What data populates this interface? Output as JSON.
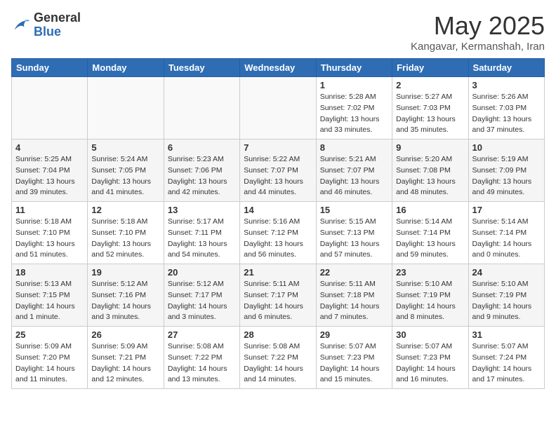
{
  "header": {
    "logo_line1": "General",
    "logo_line2": "Blue",
    "month": "May 2025",
    "location": "Kangavar, Kermanshah, Iran"
  },
  "weekdays": [
    "Sunday",
    "Monday",
    "Tuesday",
    "Wednesday",
    "Thursday",
    "Friday",
    "Saturday"
  ],
  "weeks": [
    [
      {
        "day": "",
        "info": ""
      },
      {
        "day": "",
        "info": ""
      },
      {
        "day": "",
        "info": ""
      },
      {
        "day": "",
        "info": ""
      },
      {
        "day": "1",
        "info": "Sunrise: 5:28 AM\nSunset: 7:02 PM\nDaylight: 13 hours\nand 33 minutes."
      },
      {
        "day": "2",
        "info": "Sunrise: 5:27 AM\nSunset: 7:03 PM\nDaylight: 13 hours\nand 35 minutes."
      },
      {
        "day": "3",
        "info": "Sunrise: 5:26 AM\nSunset: 7:03 PM\nDaylight: 13 hours\nand 37 minutes."
      }
    ],
    [
      {
        "day": "4",
        "info": "Sunrise: 5:25 AM\nSunset: 7:04 PM\nDaylight: 13 hours\nand 39 minutes."
      },
      {
        "day": "5",
        "info": "Sunrise: 5:24 AM\nSunset: 7:05 PM\nDaylight: 13 hours\nand 41 minutes."
      },
      {
        "day": "6",
        "info": "Sunrise: 5:23 AM\nSunset: 7:06 PM\nDaylight: 13 hours\nand 42 minutes."
      },
      {
        "day": "7",
        "info": "Sunrise: 5:22 AM\nSunset: 7:07 PM\nDaylight: 13 hours\nand 44 minutes."
      },
      {
        "day": "8",
        "info": "Sunrise: 5:21 AM\nSunset: 7:07 PM\nDaylight: 13 hours\nand 46 minutes."
      },
      {
        "day": "9",
        "info": "Sunrise: 5:20 AM\nSunset: 7:08 PM\nDaylight: 13 hours\nand 48 minutes."
      },
      {
        "day": "10",
        "info": "Sunrise: 5:19 AM\nSunset: 7:09 PM\nDaylight: 13 hours\nand 49 minutes."
      }
    ],
    [
      {
        "day": "11",
        "info": "Sunrise: 5:18 AM\nSunset: 7:10 PM\nDaylight: 13 hours\nand 51 minutes."
      },
      {
        "day": "12",
        "info": "Sunrise: 5:18 AM\nSunset: 7:10 PM\nDaylight: 13 hours\nand 52 minutes."
      },
      {
        "day": "13",
        "info": "Sunrise: 5:17 AM\nSunset: 7:11 PM\nDaylight: 13 hours\nand 54 minutes."
      },
      {
        "day": "14",
        "info": "Sunrise: 5:16 AM\nSunset: 7:12 PM\nDaylight: 13 hours\nand 56 minutes."
      },
      {
        "day": "15",
        "info": "Sunrise: 5:15 AM\nSunset: 7:13 PM\nDaylight: 13 hours\nand 57 minutes."
      },
      {
        "day": "16",
        "info": "Sunrise: 5:14 AM\nSunset: 7:14 PM\nDaylight: 13 hours\nand 59 minutes."
      },
      {
        "day": "17",
        "info": "Sunrise: 5:14 AM\nSunset: 7:14 PM\nDaylight: 14 hours\nand 0 minutes."
      }
    ],
    [
      {
        "day": "18",
        "info": "Sunrise: 5:13 AM\nSunset: 7:15 PM\nDaylight: 14 hours\nand 1 minute."
      },
      {
        "day": "19",
        "info": "Sunrise: 5:12 AM\nSunset: 7:16 PM\nDaylight: 14 hours\nand 3 minutes."
      },
      {
        "day": "20",
        "info": "Sunrise: 5:12 AM\nSunset: 7:17 PM\nDaylight: 14 hours\nand 3 minutes."
      },
      {
        "day": "21",
        "info": "Sunrise: 5:11 AM\nSunset: 7:17 PM\nDaylight: 14 hours\nand 6 minutes."
      },
      {
        "day": "22",
        "info": "Sunrise: 5:11 AM\nSunset: 7:18 PM\nDaylight: 14 hours\nand 7 minutes."
      },
      {
        "day": "23",
        "info": "Sunrise: 5:10 AM\nSunset: 7:19 PM\nDaylight: 14 hours\nand 8 minutes."
      },
      {
        "day": "24",
        "info": "Sunrise: 5:10 AM\nSunset: 7:19 PM\nDaylight: 14 hours\nand 9 minutes."
      }
    ],
    [
      {
        "day": "25",
        "info": "Sunrise: 5:09 AM\nSunset: 7:20 PM\nDaylight: 14 hours\nand 11 minutes."
      },
      {
        "day": "26",
        "info": "Sunrise: 5:09 AM\nSunset: 7:21 PM\nDaylight: 14 hours\nand 12 minutes."
      },
      {
        "day": "27",
        "info": "Sunrise: 5:08 AM\nSunset: 7:22 PM\nDaylight: 14 hours\nand 13 minutes."
      },
      {
        "day": "28",
        "info": "Sunrise: 5:08 AM\nSunset: 7:22 PM\nDaylight: 14 hours\nand 14 minutes."
      },
      {
        "day": "29",
        "info": "Sunrise: 5:07 AM\nSunset: 7:23 PM\nDaylight: 14 hours\nand 15 minutes."
      },
      {
        "day": "30",
        "info": "Sunrise: 5:07 AM\nSunset: 7:23 PM\nDaylight: 14 hours\nand 16 minutes."
      },
      {
        "day": "31",
        "info": "Sunrise: 5:07 AM\nSunset: 7:24 PM\nDaylight: 14 hours\nand 17 minutes."
      }
    ]
  ]
}
